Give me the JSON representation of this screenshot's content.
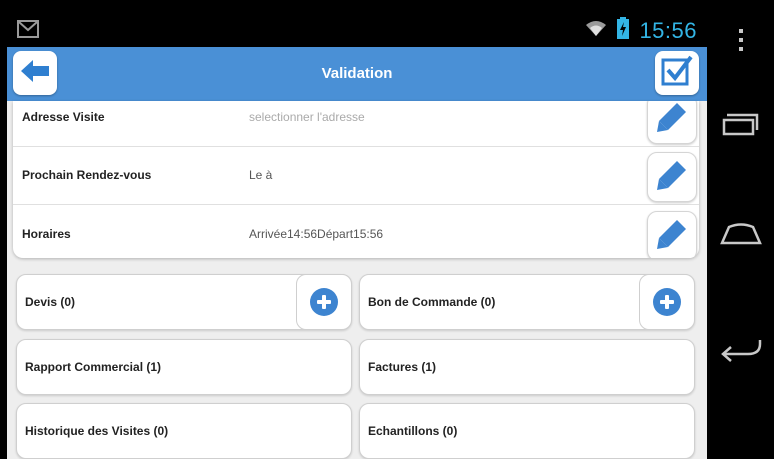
{
  "status_bar": {
    "notification_icon": "gmail-icon",
    "wifi_icon": "wifi-icon",
    "battery_icon": "battery-charging-icon",
    "time": "15:56"
  },
  "app_bar": {
    "title": "Validation",
    "back_icon": "back-arrow-icon",
    "validate_icon": "checkbox-check-icon"
  },
  "form": {
    "rows": [
      {
        "label": "Adresse Visite",
        "value": "selectionner l'adresse",
        "edit_icon": "pencil-icon"
      },
      {
        "label": "Prochain Rendez-vous",
        "value": "Le à",
        "edit_icon": "pencil-icon"
      },
      {
        "label": "Horaires",
        "value": "Arrivée14:56Départ15:56",
        "edit_icon": "pencil-icon"
      }
    ]
  },
  "cards": {
    "devis": {
      "label": "Devis  (0)",
      "action_icon": "plus-circle-icon"
    },
    "bon_commande": {
      "label": "Bon de Commande  (0)",
      "action_icon": "plus-circle-icon"
    },
    "rapport": {
      "label": "Rapport Commercial (1)"
    },
    "factures": {
      "label": "Factures (1)"
    },
    "historique": {
      "label": "Historique des Visites  (0)"
    },
    "echantillons": {
      "label": "Echantillons  (0)"
    }
  },
  "nav_bar": {
    "menu_icon": "overflow-menu-icon",
    "recents_icon": "recent-apps-icon",
    "home_icon": "home-icon",
    "back_icon": "back-icon"
  },
  "colors": {
    "accent": "#4a90d6",
    "status_text": "#33b5e5",
    "icon_blue": "#3d84d0"
  }
}
